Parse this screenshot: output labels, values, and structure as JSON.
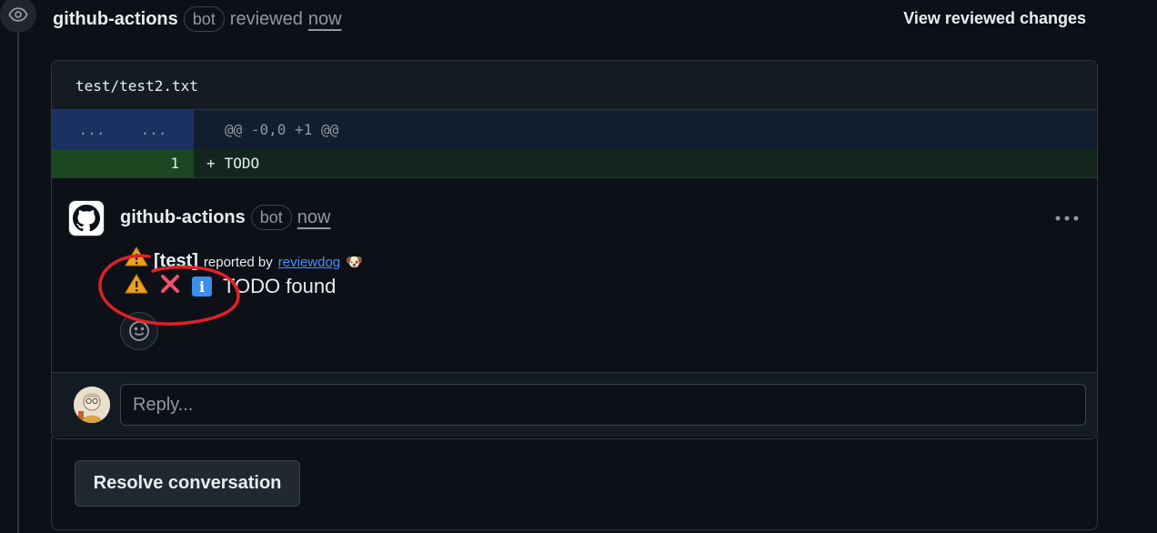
{
  "review": {
    "author": "github-actions",
    "bot_label": "bot",
    "action": "reviewed",
    "time": "now",
    "view_changes_label": "View reviewed changes"
  },
  "diff": {
    "file_path": "test/test2.txt",
    "hunk_old": "...",
    "hunk_new": "...",
    "hunk_header": "@@ -0,0 +1 @@",
    "added_line_number": "1",
    "added_sign": "+",
    "added_text": "TODO"
  },
  "comment": {
    "author": "github-actions",
    "bot_label": "bot",
    "time": "now",
    "prefix": "[test]",
    "reported_by": "reported by",
    "reporter_link": "reviewdog",
    "reporter_emoji": "🐶",
    "message": "TODO found",
    "icons": [
      "warning-icon",
      "cross-mark-icon",
      "info-icon"
    ]
  },
  "reply": {
    "placeholder": "Reply..."
  },
  "resolve": {
    "label": "Resolve conversation"
  },
  "colors": {
    "background": "#0d1117",
    "link": "#4493f8",
    "hunk_bg": "#121d2f",
    "add_bg": "#12261e",
    "annotation_red": "#e0202a"
  }
}
